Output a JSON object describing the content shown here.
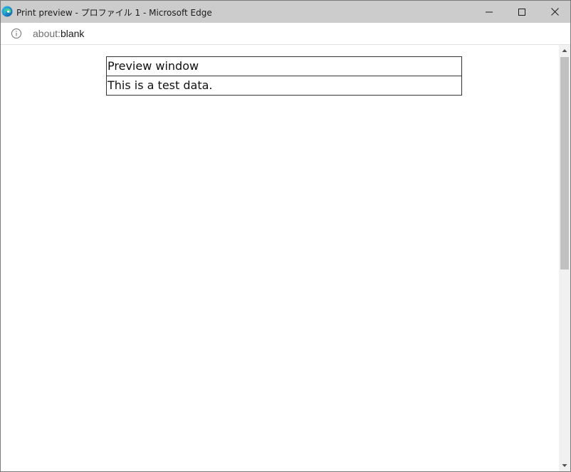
{
  "window": {
    "title": "Print preview - プロファイル 1 - Microsoft Edge",
    "app_icon": "edge-logo-icon",
    "buttons": {
      "minimize": "minimize-icon",
      "maximize": "maximize-icon",
      "close": "close-icon"
    }
  },
  "addressbar": {
    "info_icon": "info-icon",
    "url_scheme": "about:",
    "url_rest": "blank"
  },
  "content": {
    "table": {
      "rows": [
        "Preview window",
        "This is a test data."
      ]
    }
  },
  "colors": {
    "titlebar": "#cccccc",
    "border": "#333333",
    "scroll_thumb": "#c1c1c1"
  }
}
